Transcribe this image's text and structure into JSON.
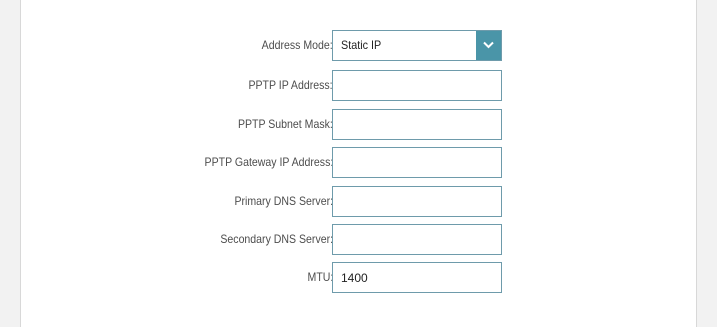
{
  "form": {
    "address_mode": {
      "label": "Address Mode:",
      "value": "Static IP",
      "icon": "chevron-down-icon"
    },
    "pptp_ip": {
      "label": "PPTP IP Address:",
      "value": ""
    },
    "pptp_subnet": {
      "label": "PPTP Subnet Mask:",
      "value": ""
    },
    "pptp_gateway": {
      "label": "PPTP Gateway IP Address:",
      "value": ""
    },
    "primary_dns": {
      "label": "Primary DNS Server:",
      "value": ""
    },
    "secondary_dns": {
      "label": "Secondary DNS Server:",
      "value": ""
    },
    "mtu": {
      "label": "MTU:",
      "value": "1400"
    }
  },
  "colors": {
    "accent": "#4a95a8",
    "field_border": "#6e9bab",
    "label_text": "#4d4d4d"
  }
}
